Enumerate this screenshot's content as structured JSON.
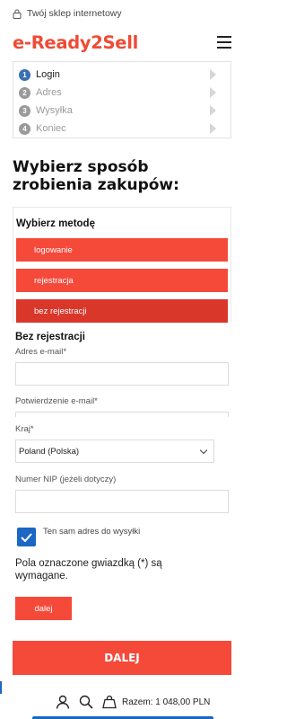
{
  "topbar": {
    "tagline": "Twój sklep internetowy",
    "icon": "lock-icon"
  },
  "header": {
    "logo": "e-Ready2Sell",
    "menu_icon": "hamburger-menu-icon"
  },
  "steps": [
    {
      "number": "1",
      "label": "Login",
      "active": true
    },
    {
      "number": "2",
      "label": "Adres",
      "active": false
    },
    {
      "number": "3",
      "label": "Wysyłka",
      "active": false
    },
    {
      "number": "4",
      "label": "Koniec",
      "active": false
    }
  ],
  "main": {
    "title": "Wybierz sposób zrobienia zakupów:"
  },
  "methods": {
    "heading": "Wybierz metodę",
    "options": [
      "logowanie",
      "rejestracja",
      "bez rejestracji"
    ],
    "selected": "bez rejestracji"
  },
  "guest_form": {
    "title": "Bez rejestracji",
    "email_label": "Adres e-mail*",
    "email_value": "",
    "email_confirm_label": "Potwierdzenie e-mail*",
    "email_confirm_value": "",
    "country_label": "Kraj*",
    "country_value": "Poland (Polska)",
    "nip_label": "Numer NIP (jeżeli dotyczy)",
    "nip_value": "",
    "same_address_label": "Ten sam adres do wysyłki",
    "same_address_checked": true,
    "required_note": "Pola oznaczone gwiazdką (*) są wymagane.",
    "next_small": "dalej"
  },
  "primary_button": {
    "label": "DALEJ"
  },
  "bottom_bar": {
    "icons": [
      "user-icon",
      "search-icon",
      "cart-icon"
    ],
    "cart_total": "Razem: 1 048,00 PLN"
  },
  "colors": {
    "accent": "#f5493a",
    "accent_dark": "#d9372a",
    "logo": "#f04a34",
    "blue": "#1c66c4",
    "step_active": "#3a6fb0"
  }
}
